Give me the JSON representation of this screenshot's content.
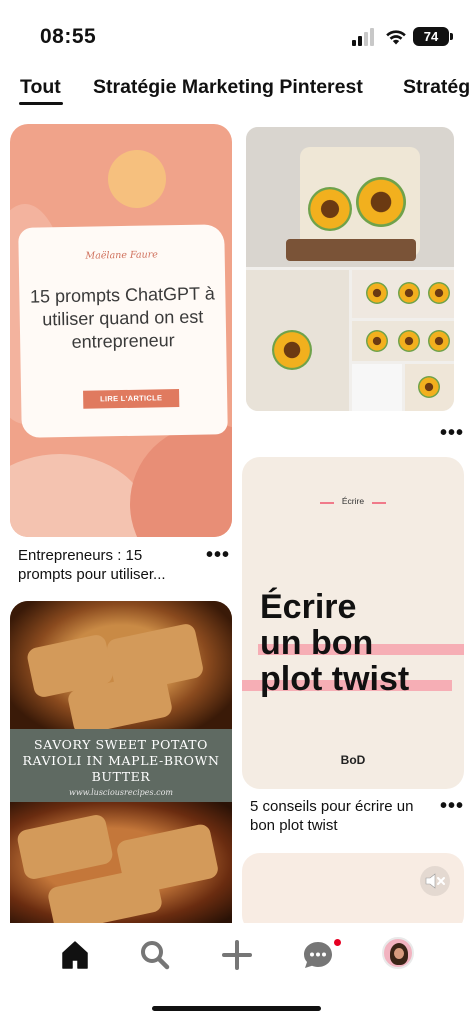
{
  "status_bar": {
    "time": "08:55",
    "battery": "74"
  },
  "tabs": [
    {
      "label": "Tout",
      "selected": true
    },
    {
      "label": "Stratégie Marketing Pinterest",
      "selected": false
    },
    {
      "label": "Stratég",
      "selected": false
    }
  ],
  "pins": {
    "entrepreneur": {
      "author": "Maëlane Faure",
      "headline": "15 prompts ChatGPT à utiliser quand on est entrepreneur",
      "cta": "LIRE L'ARTICLE",
      "caption": "Entrepreneurs : 15 prompts pour utiliser..."
    },
    "crochet": {},
    "ravioli": {
      "title": "SAVORY SWEET POTATO RAVIOLI IN MAPLE-BROWN BUTTER",
      "url": "www.lusciousrecipes.com"
    },
    "plot_twist": {
      "kicker": "Écrire",
      "line1": "Écrire",
      "line2": "un bon",
      "line3": "plot twist",
      "brand": "BoD",
      "caption": "5 conseils pour écrire un bon plot twist"
    }
  },
  "more_label": "•••",
  "nav": {
    "items": [
      "home-icon",
      "search-icon",
      "add-icon",
      "messages-icon",
      "profile-avatar"
    ],
    "messages_badge": true
  },
  "colors": {
    "accent": "#e60023",
    "pin1_bg": "#f0a38a",
    "pin4_stripe": "#f6aeb5"
  }
}
